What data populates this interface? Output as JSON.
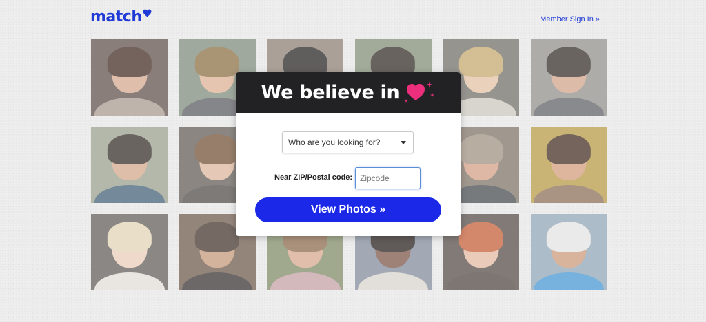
{
  "header": {
    "logo_text": "match",
    "signin_label": "Member Sign In »"
  },
  "colors": {
    "brand_blue": "#1f3ad6",
    "cta_blue": "#1c28e8",
    "heart_pink": "#ec2f7d",
    "modal_header": "#222224"
  },
  "modal": {
    "title": "We believe in",
    "title_icon": "heart-icon",
    "seeking_select": {
      "value": "Who are you looking for?"
    },
    "zip_label": "Near ZIP/Postal code:",
    "zip_input": {
      "value": "",
      "placeholder": "Zipcode"
    },
    "cta_label": "View Photos »"
  },
  "photos": [
    {
      "id": "p1"
    },
    {
      "id": "p2"
    },
    {
      "id": "p3"
    },
    {
      "id": "p4"
    },
    {
      "id": "p5"
    },
    {
      "id": "p6"
    },
    {
      "id": "p7"
    },
    {
      "id": "p8"
    },
    {
      "id": "p9"
    },
    {
      "id": "p10"
    },
    {
      "id": "p11"
    },
    {
      "id": "p12"
    },
    {
      "id": "p13"
    },
    {
      "id": "p14"
    },
    {
      "id": "p15"
    },
    {
      "id": "p16"
    },
    {
      "id": "p17"
    },
    {
      "id": "p18"
    }
  ]
}
